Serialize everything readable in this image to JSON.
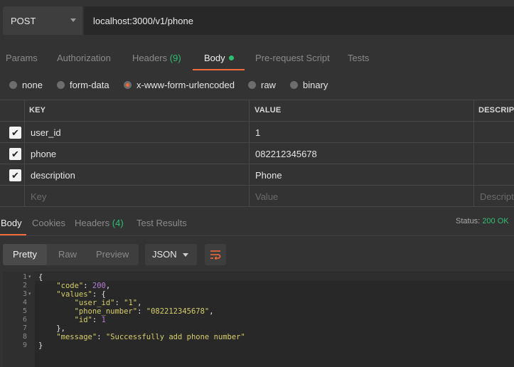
{
  "request": {
    "method": "POST",
    "url": "localhost:3000/v1/phone"
  },
  "request_tabs": {
    "params": "Params",
    "authorization": "Authorization",
    "headers": "Headers",
    "headers_count": "(9)",
    "body": "Body",
    "prerequest": "Pre-request Script",
    "tests": "Tests"
  },
  "body_types": {
    "none": "none",
    "form_data": "form-data",
    "urlencoded": "x-www-form-urlencoded",
    "raw": "raw",
    "binary": "binary",
    "selected": "x-www-form-urlencoded"
  },
  "params_table": {
    "headers": {
      "key": "KEY",
      "value": "VALUE",
      "description": "DESCRIPTI"
    },
    "rows": [
      {
        "checked": true,
        "key": "user_id",
        "value": "1",
        "description": ""
      },
      {
        "checked": true,
        "key": "phone",
        "value": "082212345678",
        "description": ""
      },
      {
        "checked": true,
        "key": "description",
        "value": "Phone",
        "description": ""
      }
    ],
    "placeholder": {
      "key": "Key",
      "value": "Value",
      "description": "Descripti"
    }
  },
  "response_tabs": {
    "body": "Body",
    "cookies": "Cookies",
    "headers": "Headers",
    "headers_count": "(4)",
    "test_results": "Test Results"
  },
  "status": {
    "label": "Status:",
    "value": "200 OK"
  },
  "view_modes": {
    "pretty": "Pretty",
    "raw": "Raw",
    "preview": "Preview",
    "selected": "Pretty"
  },
  "format": "JSON",
  "code": {
    "line_numbers": [
      "1",
      "2",
      "3",
      "4",
      "5",
      "6",
      "7",
      "8",
      "9"
    ],
    "lines": [
      "{",
      "    \"code\": 200,",
      "    \"values\": {",
      "        \"user_id\": \"1\",",
      "        \"phone_number\": \"082212345678\",",
      "        \"id\": 1",
      "    },",
      "    \"message\": \"Successfully add phone number\"",
      "}"
    ]
  },
  "colors": {
    "accent": "#f26b3a",
    "success": "#2fbf71",
    "json_key": "#d6cf6b",
    "json_number": "#b57bd6"
  }
}
